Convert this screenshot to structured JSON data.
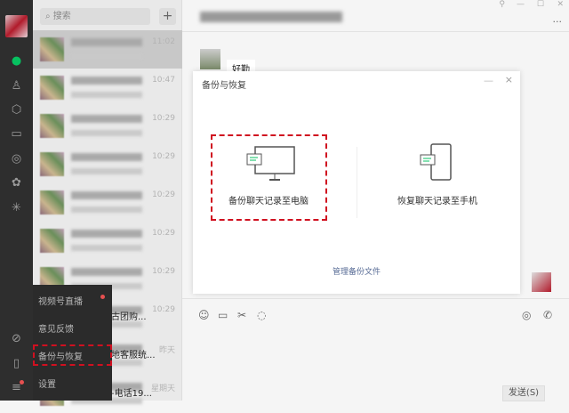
{
  "search": {
    "placeholder": "搜索",
    "add": "+"
  },
  "chats": [
    {
      "time": "11:02"
    },
    {
      "time": "10:47"
    },
    {
      "time": "10:29"
    },
    {
      "time": "10:29"
    },
    {
      "time": "10:29"
    },
    {
      "time": "10:29"
    },
    {
      "time": "10:29"
    },
    {
      "time": "10:29",
      "text": "古团购..."
    },
    {
      "time": "昨天",
      "text": "地客服统..."
    },
    {
      "time": "星期天",
      "text": "-电话19..."
    }
  ],
  "menu": {
    "items": [
      "视频号直播",
      "意见反馈",
      "备份与恢复",
      "设置"
    ]
  },
  "chat": {
    "bubble": "好勤",
    "send": "发送(S)"
  },
  "dialog": {
    "title": "备份与恢复",
    "backup": "备份聊天记录至电脑",
    "restore": "恢复聊天记录至手机",
    "manage": "管理备份文件",
    "minimize": "—",
    "close": "×"
  },
  "window": {
    "minimize": "—",
    "maximize": "☐",
    "close": "✕",
    "more": "···"
  },
  "colors": {
    "accent": "#07c160",
    "highlight": "#d01020"
  }
}
